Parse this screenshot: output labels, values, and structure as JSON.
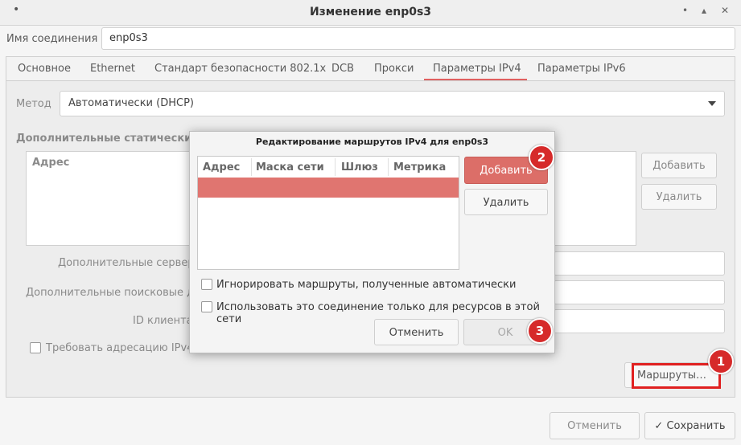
{
  "window": {
    "title": "Изменение enp0s3",
    "dot": "•",
    "minimize": "•",
    "maximize": "▴",
    "close": "✕"
  },
  "connection": {
    "label": "Имя соединения",
    "value": "enp0s3"
  },
  "tabs": [
    {
      "label": "Основное"
    },
    {
      "label": "Ethernet"
    },
    {
      "label": "Стандарт безопасности 802.1x"
    },
    {
      "label": "DCB"
    },
    {
      "label": "Прокси"
    },
    {
      "label": "Параметры IPv4"
    },
    {
      "label": "Параметры IPv6"
    }
  ],
  "method": {
    "label": "Метод",
    "value": "Автоматически (DHCP)"
  },
  "static": {
    "title": "Дополнительные статические",
    "column": "Адрес",
    "add": "Добавить",
    "remove": "Удалить"
  },
  "form": {
    "dns_label": "Дополнительные серверы",
    "search_label": "Дополнительные поисковые до",
    "client_id_label": "ID клиента",
    "require_ipv4_label": "Требовать адресацию IPv4 д"
  },
  "routes_button": "Маршруты…",
  "footer": {
    "cancel": "Отменить",
    "save": "Сохранить",
    "save_icon": "✓"
  },
  "dialog": {
    "title": "Редактирование маршрутов IPv4 для enp0s3",
    "columns": [
      "Адрес",
      "Маска сети",
      "Шлюз",
      "Метрика"
    ],
    "add": "Добавить",
    "remove": "Удалить",
    "ignore_auto": "Игнорировать маршруты, полученные автоматически",
    "only_local": "Использовать это соединение только для ресурсов в этой сети",
    "cancel": "Отменить",
    "ok": "OK"
  },
  "badges": [
    "1",
    "2",
    "3"
  ],
  "colors": {
    "accent": "#dc6e68",
    "badge": "#d62a2a",
    "highlight": "#e02020"
  }
}
